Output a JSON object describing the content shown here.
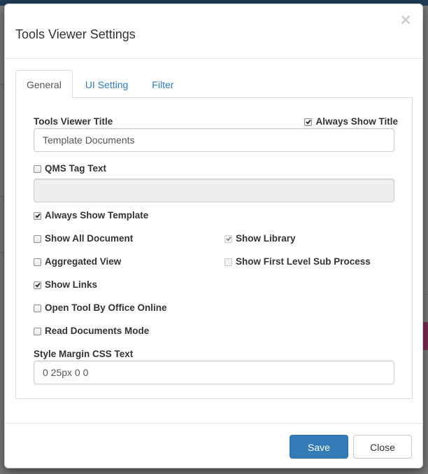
{
  "modal": {
    "title": "Tools Viewer Settings",
    "close_glyph": "×"
  },
  "tabs": [
    {
      "label": "General",
      "active": true
    },
    {
      "label": "UI Setting",
      "active": false
    },
    {
      "label": "Filter",
      "active": false
    }
  ],
  "general": {
    "title_label": "Tools Viewer Title",
    "always_show_title": {
      "label": "Always Show Title",
      "checked": true
    },
    "title_value": "Template Documents",
    "qms_tag": {
      "label": "QMS Tag Text",
      "checked": false
    },
    "qms_tag_value": "",
    "always_show_template": {
      "label": "Always Show Template",
      "checked": true
    },
    "show_all_document": {
      "label": "Show All Document",
      "checked": false
    },
    "show_library": {
      "label": "Show Library",
      "checked": true,
      "disabled": true
    },
    "aggregated_view": {
      "label": "Aggregated View",
      "checked": false
    },
    "show_first_level_sub_process": {
      "label": "Show First Level Sub Process",
      "checked": false,
      "disabled": true
    },
    "show_links": {
      "label": "Show Links",
      "checked": true
    },
    "open_tool_by_office_online": {
      "label": "Open Tool By Office Online",
      "checked": false
    },
    "read_documents_mode": {
      "label": "Read Documents Mode",
      "checked": false
    },
    "style_margin_label": "Style Margin CSS Text",
    "style_margin_value": "0 25px 0 0"
  },
  "footer": {
    "save_label": "Save",
    "close_label": "Close"
  },
  "colors": {
    "primary": "#337ab7",
    "link": "#337ab7",
    "overlay": "#6f6f6f"
  },
  "icons": {
    "close": "close-icon",
    "checkbox_checked": "checkmark-icon"
  }
}
